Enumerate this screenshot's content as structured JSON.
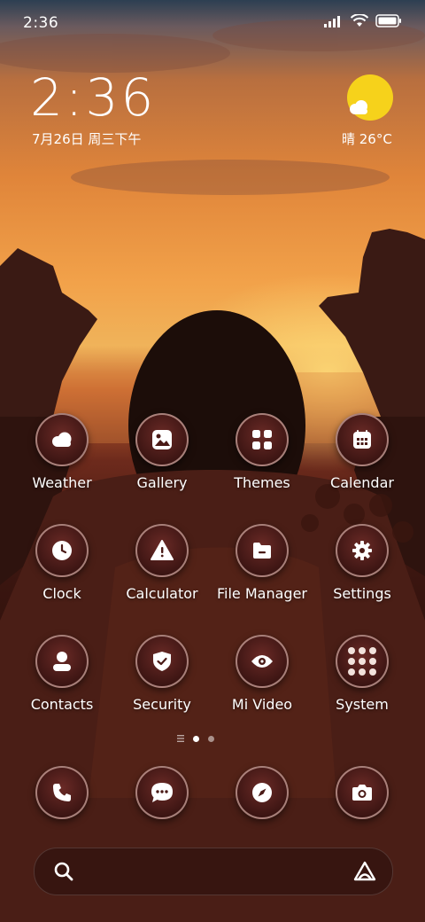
{
  "status_bar": {
    "time": "2:36"
  },
  "clock_widget": {
    "time": "2:36",
    "date": "7月26日 周三下午"
  },
  "weather_widget": {
    "text": "晴 26°C",
    "icon": "sun-cloud-icon",
    "sun_color": "#f6d21b"
  },
  "apps": [
    {
      "label": "Weather",
      "icon": "cloud-icon"
    },
    {
      "label": "Gallery",
      "icon": "image-icon"
    },
    {
      "label": "Themes",
      "icon": "grid-icon"
    },
    {
      "label": "Calendar",
      "icon": "calendar-icon"
    },
    {
      "label": "Clock",
      "icon": "clock-icon"
    },
    {
      "label": "Calculator",
      "icon": "warning-icon"
    },
    {
      "label": "File Manager",
      "icon": "folder-icon"
    },
    {
      "label": "Settings",
      "icon": "gear-icon"
    },
    {
      "label": "Contacts",
      "icon": "person-icon"
    },
    {
      "label": "Security",
      "icon": "shield-icon"
    },
    {
      "label": "Mi Video",
      "icon": "eye-icon"
    },
    {
      "label": "System",
      "icon": "folder-grid-icon"
    }
  ],
  "dock": [
    {
      "icon": "phone-icon"
    },
    {
      "icon": "message-icon"
    },
    {
      "icon": "compass-icon"
    },
    {
      "icon": "camera-icon"
    }
  ],
  "search_bar": {
    "left_icon": "search-icon",
    "right_icon": "assistant-icon"
  },
  "colors": {
    "icon_bg": "#3a1412",
    "icon_border": "#ffd7cd",
    "sun": "#f6d21b"
  }
}
